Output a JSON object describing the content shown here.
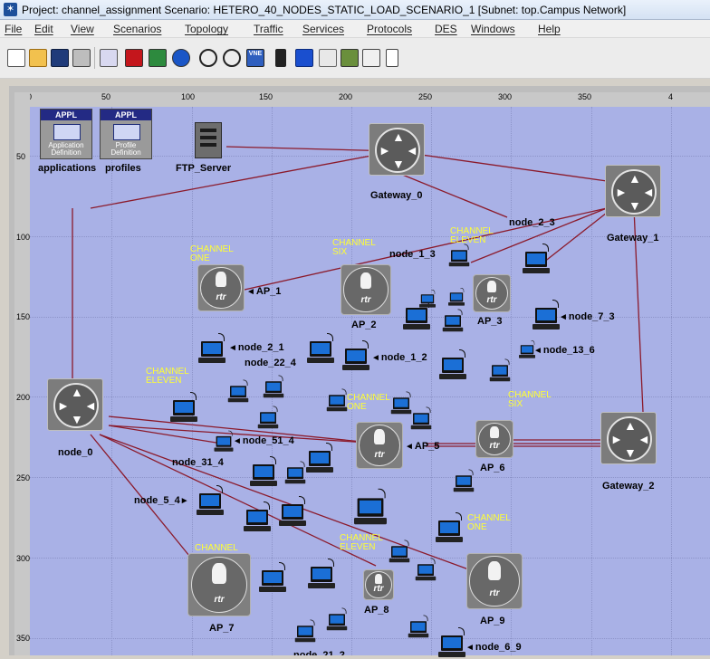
{
  "window": {
    "title": "Project: channel_assignment Scenario: HETERO_40_NODES_STATIC_LOAD_SCENARIO_1  [Subnet: top.Campus Network]",
    "app_icon": "opnet-star-icon"
  },
  "menu": [
    "File",
    "Edit",
    "View",
    "Scenarios",
    "Topology",
    "Traffic",
    "Services",
    "Protocols",
    "DES",
    "Windows",
    "Help"
  ],
  "toolbar": {
    "buttons": [
      "new-project-icon",
      "open-folder-icon",
      "save-disk-icon",
      "print-icon",
      "object-palette-icon",
      "failure-icon",
      "recovery-icon",
      "node-config-icon",
      "zoom-in-icon",
      "zoom-out-icon",
      "vne-server-icon",
      "traffic-light-icon",
      "triangle-icon",
      "run-simulation-icon",
      "results-icon",
      "graph-icon",
      "ruler-icon"
    ],
    "vne_label": "VNE"
  },
  "ruler": {
    "x_ticks": [
      "0",
      "50",
      "100",
      "150",
      "200",
      "250",
      "300",
      "350",
      "4"
    ],
    "y_ticks": [
      "50",
      "100",
      "150",
      "200",
      "250",
      "300",
      "350"
    ]
  },
  "nodes": {
    "applications": {
      "label": "applications",
      "header": "APPL",
      "caption": "Application Definition"
    },
    "profiles": {
      "label": "profiles",
      "header": "APPL",
      "caption": "Profile Definition"
    },
    "ftp_server": "FTP_Server",
    "gateway_0": "Gateway_0",
    "gateway_1": "Gateway_1",
    "gateway_2": "Gateway_2",
    "node_0": "node_0",
    "ap_1": "AP_1",
    "ap_2": "AP_2",
    "ap_3": "AP_3",
    "ap_5": "AP_5",
    "ap_6": "AP_6",
    "ap_7": "AP_7",
    "ap_8": "AP_8",
    "ap_9": "AP_9",
    "node_2_3": "node_2_3",
    "node_1_3": "node_1_3",
    "node_7_3": "node_7_3",
    "node_13_6": "node_13_6",
    "node_2_1": "node_2_1",
    "node_22_4": "node_22_4",
    "node_1_2": "node_1_2",
    "node_51_4": "node_51_4",
    "node_31_4": "node_31_4",
    "node_5_4": "node_5_4",
    "node_6_9": "node_6_9",
    "node_partial": "node_21_2",
    "rtr": "rtr"
  },
  "channels": {
    "ap1": "CHANNEL ONE",
    "ap2": "CHANNEL SIX",
    "ap3": "CHANNEL ELEVEN",
    "eleven_left": "CHANNEL ELEVEN",
    "ap5": "CHANNEL ONE",
    "ap6": "CHANNEL SIX",
    "ap7": "CHANNEL",
    "ap8": "CHANNEL ELEVEN",
    "ap9": "CHANNEL ONE"
  },
  "colors": {
    "canvas": "#a9b1e6",
    "link": "#8b1a2b",
    "channel_text": "#ffff33"
  }
}
